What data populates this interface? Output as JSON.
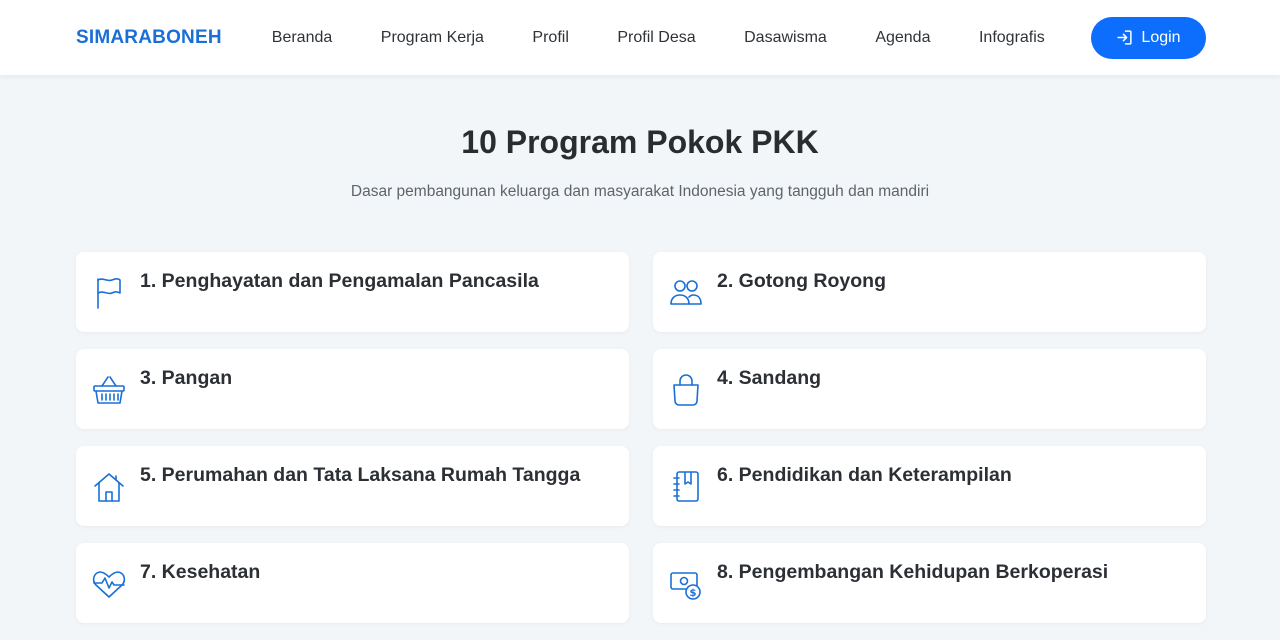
{
  "nav": {
    "brand": "SIMARABONEH",
    "links": [
      "Beranda",
      "Program Kerja",
      "Profil",
      "Profil Desa",
      "Dasawisma",
      "Agenda",
      "Infografis"
    ],
    "login_label": "Login"
  },
  "hero": {
    "title": "10 Program Pokok PKK",
    "subtitle": "Dasar pembangunan keluarga dan masyarakat Indonesia yang tangguh dan mandiri"
  },
  "programs": [
    {
      "title": "1. Penghayatan dan Pengamalan Pancasila",
      "icon": "flag-icon"
    },
    {
      "title": "2. Gotong Royong",
      "icon": "people-icon"
    },
    {
      "title": "3. Pangan",
      "icon": "basket-icon"
    },
    {
      "title": "4. Sandang",
      "icon": "shopping-bag-icon"
    },
    {
      "title": "5. Perumahan dan Tata Laksana Rumah Tangga",
      "icon": "house-icon"
    },
    {
      "title": "6. Pendidikan dan Keterampilan",
      "icon": "book-icon"
    },
    {
      "title": "7. Kesehatan",
      "icon": "heart-pulse-icon"
    },
    {
      "title": "8. Pengembangan Kehidupan Berkoperasi",
      "icon": "cash-coin-icon"
    }
  ],
  "colors": {
    "accent": "#1a6fd6",
    "button": "#0d6efd",
    "background": "#f3f6f9"
  }
}
